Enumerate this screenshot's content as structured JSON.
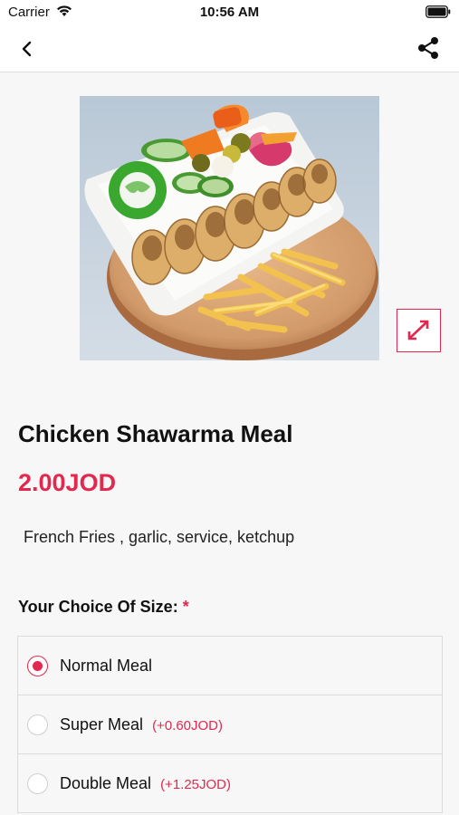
{
  "status_bar": {
    "carrier": "Carrier",
    "time": "10:56 AM"
  },
  "nav": {
    "back_icon": "chevron-left-icon",
    "share_icon": "share-icon"
  },
  "product": {
    "image_description_icon": "food-photo",
    "title": "Chicken Shawarma Meal",
    "price": "2.00JOD",
    "description": "French Fries , garlic, service, ketchup"
  },
  "size_choice": {
    "heading": "Your Choice Of Size:",
    "required_marker": "*",
    "options": [
      {
        "label": "Normal Meal",
        "extra": "",
        "selected": true
      },
      {
        "label": "Super Meal",
        "extra": "(+0.60JOD)",
        "selected": false
      },
      {
        "label": "Double Meal",
        "extra": "(+1.25JOD)",
        "selected": false
      }
    ]
  },
  "colors": {
    "accent": "#e2284f",
    "background": "#f7f7f7"
  }
}
